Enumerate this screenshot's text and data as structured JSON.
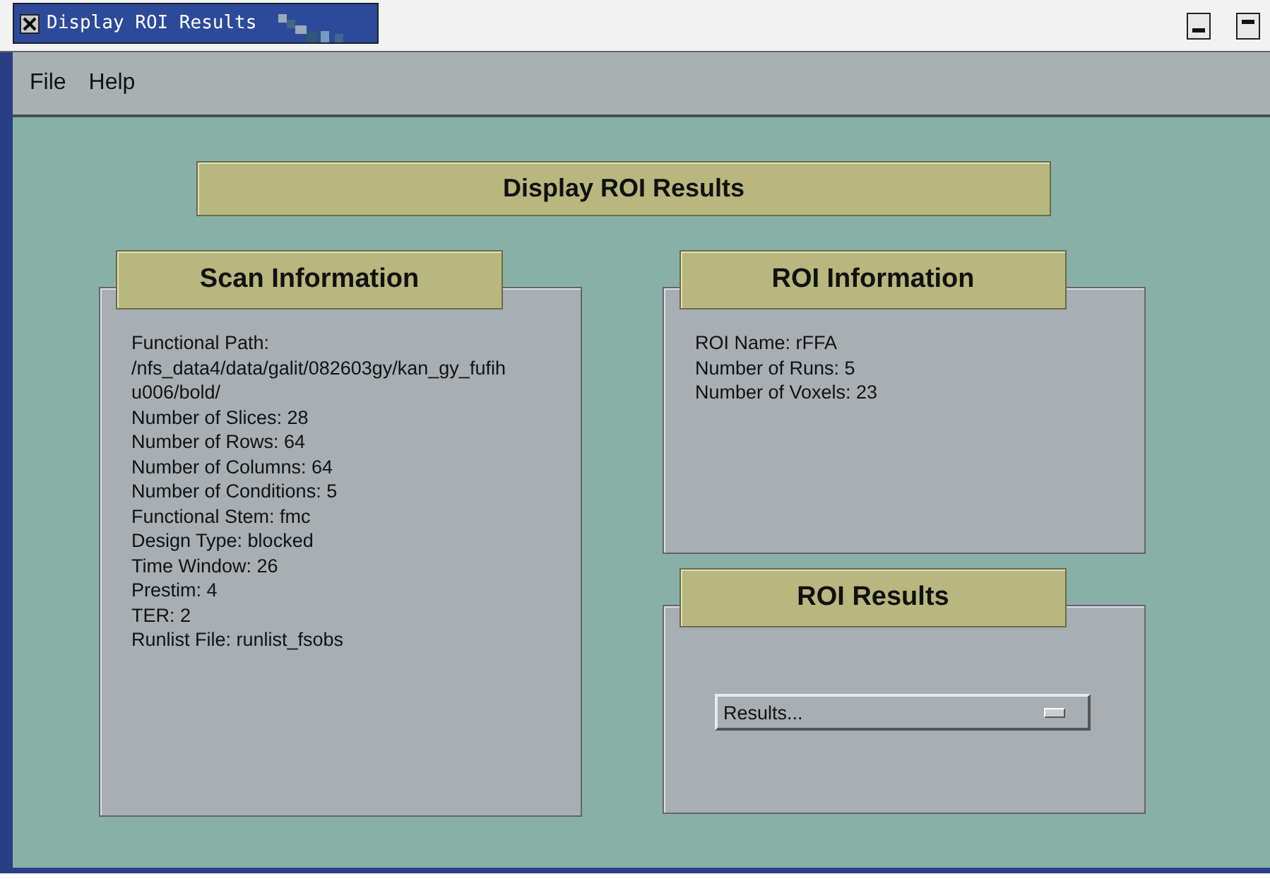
{
  "window": {
    "title": "Display ROI Results"
  },
  "menu": [
    "File",
    "Help"
  ],
  "banner": "Display ROI Results",
  "scan_information": {
    "title": "Scan Information",
    "lines": [
      "Functional Path:",
      "/nfs_data4/data/galit/082603gy/kan_gy_fufih",
      "u006/bold/",
      "Number of Slices: 28",
      "Number of Rows: 64",
      "Number of Columns: 64",
      "Number of Conditions: 5",
      "Functional Stem: fmc",
      "Design Type: blocked",
      "Time Window: 26",
      "Prestim: 4",
      "TER: 2",
      "Runlist File: runlist_fsobs"
    ]
  },
  "roi_information": {
    "title": "ROI Information",
    "lines": [
      "ROI Name: rFFA",
      "Number of Runs: 5",
      "Number of Voxels: 23"
    ]
  },
  "roi_results": {
    "title": "ROI Results",
    "dropdown": {
      "value": "Results..."
    }
  }
}
